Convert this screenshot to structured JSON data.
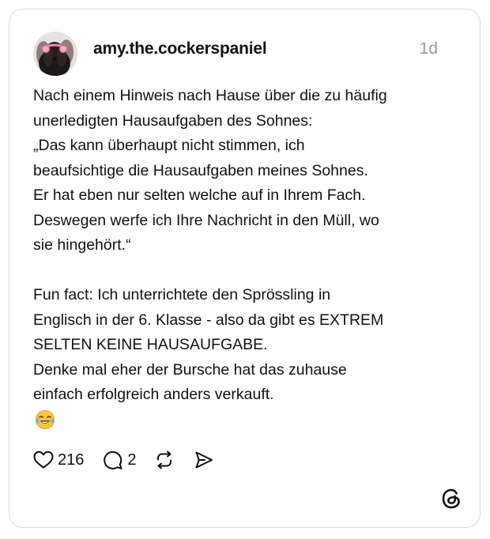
{
  "post": {
    "username": "amy.the.cockerspaniel",
    "timestamp": "1d",
    "body": "Nach einem Hinweis nach Hause über die zu häufig\nunerledigten Hausaufgaben des Sohnes:\n„Das kann überhaupt nicht stimmen, ich\nbeaufsichtige die Hausaufgaben meines Sohnes.\nEr hat eben nur selten welche auf in Ihrem Fach.\nDeswegen werfe ich Ihre Nachricht in den Müll, wo\nsie hingehört.“\n\nFun fact: Ich unterrichtete den Sprössling in\nEnglisch in der 6. Klasse - also da gibt es EXTREM\nSELTEN KEINE HAUSAUFGABE.\nDenke mal eher der Bursche hat das zuhause\neinfach erfolgreich anders verkauft.",
    "emoji": "face-with-tears-of-joy"
  },
  "actions": {
    "like_count": "216",
    "reply_count": "2",
    "like_icon": "heart-icon",
    "reply_icon": "comment-icon",
    "repost_icon": "repost-icon",
    "share_icon": "send-icon"
  },
  "branding": {
    "logo": "threads-logo-icon"
  },
  "colors": {
    "text": "#101010",
    "muted": "#9a9a9a",
    "border": "#d9d9d9",
    "background": "#ffffff"
  }
}
